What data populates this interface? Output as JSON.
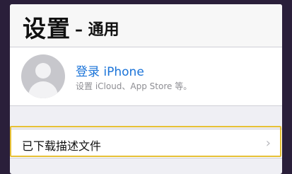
{
  "header": {
    "title": "设置",
    "subtitle": "– 通用"
  },
  "account": {
    "title": "登录 iPhone",
    "subtitle": "设置 iCloud、App Store 等。"
  },
  "profiles": {
    "label": "已下载描述文件",
    "chevron": "›"
  },
  "colors": {
    "accent": "#1a73d8",
    "highlight": "#e6c035",
    "background": "#efeff4"
  }
}
